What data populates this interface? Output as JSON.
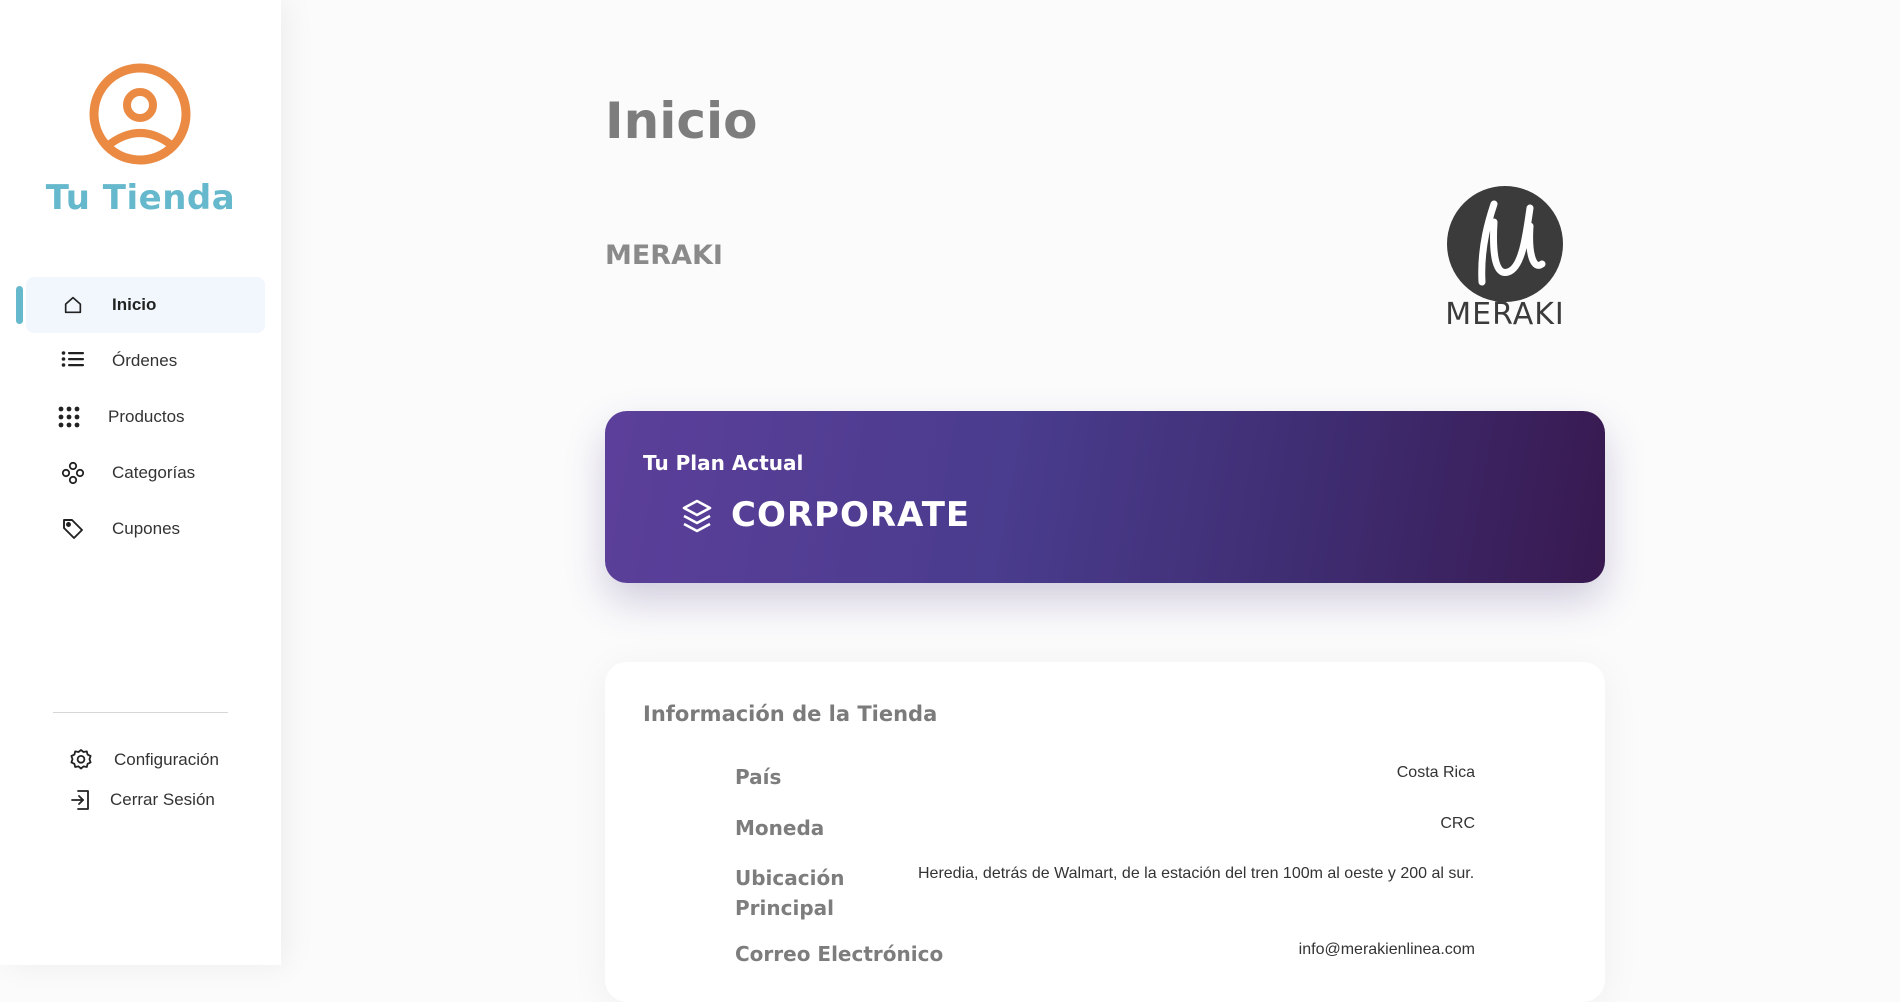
{
  "brand": {
    "name": "Tu Tienda",
    "accent": "#66b8cc",
    "logo_color": "#ea8a43"
  },
  "nav": {
    "items": [
      {
        "label": "Inicio",
        "icon": "home-icon",
        "active": true
      },
      {
        "label": "Órdenes",
        "icon": "list-icon"
      },
      {
        "label": "Productos",
        "icon": "grid-dots-icon"
      },
      {
        "label": "Categorías",
        "icon": "categories-icon"
      },
      {
        "label": "Cupones",
        "icon": "tag-icon"
      }
    ]
  },
  "footer_nav": {
    "settings_label": "Configuración",
    "logout_label": "Cerrar Sesión"
  },
  "main": {
    "title": "Inicio",
    "store_name": "MERAKI",
    "store_logo_text": "MERAKI"
  },
  "plan": {
    "label": "Tu Plan Actual",
    "name": "CORPORATE",
    "icon": "layers-icon"
  },
  "store_info": {
    "title": "Información de la Tienda",
    "rows": [
      {
        "key": "País",
        "value": "Costa Rica"
      },
      {
        "key": "Moneda",
        "value": "CRC"
      },
      {
        "key": "Ubicación Principal",
        "value": "Heredia, detrás de Walmart, de la estación del tren 100m al oeste y 200 al sur."
      },
      {
        "key": "Correo Electrónico",
        "value": "info@merakienlinea.com"
      }
    ]
  }
}
